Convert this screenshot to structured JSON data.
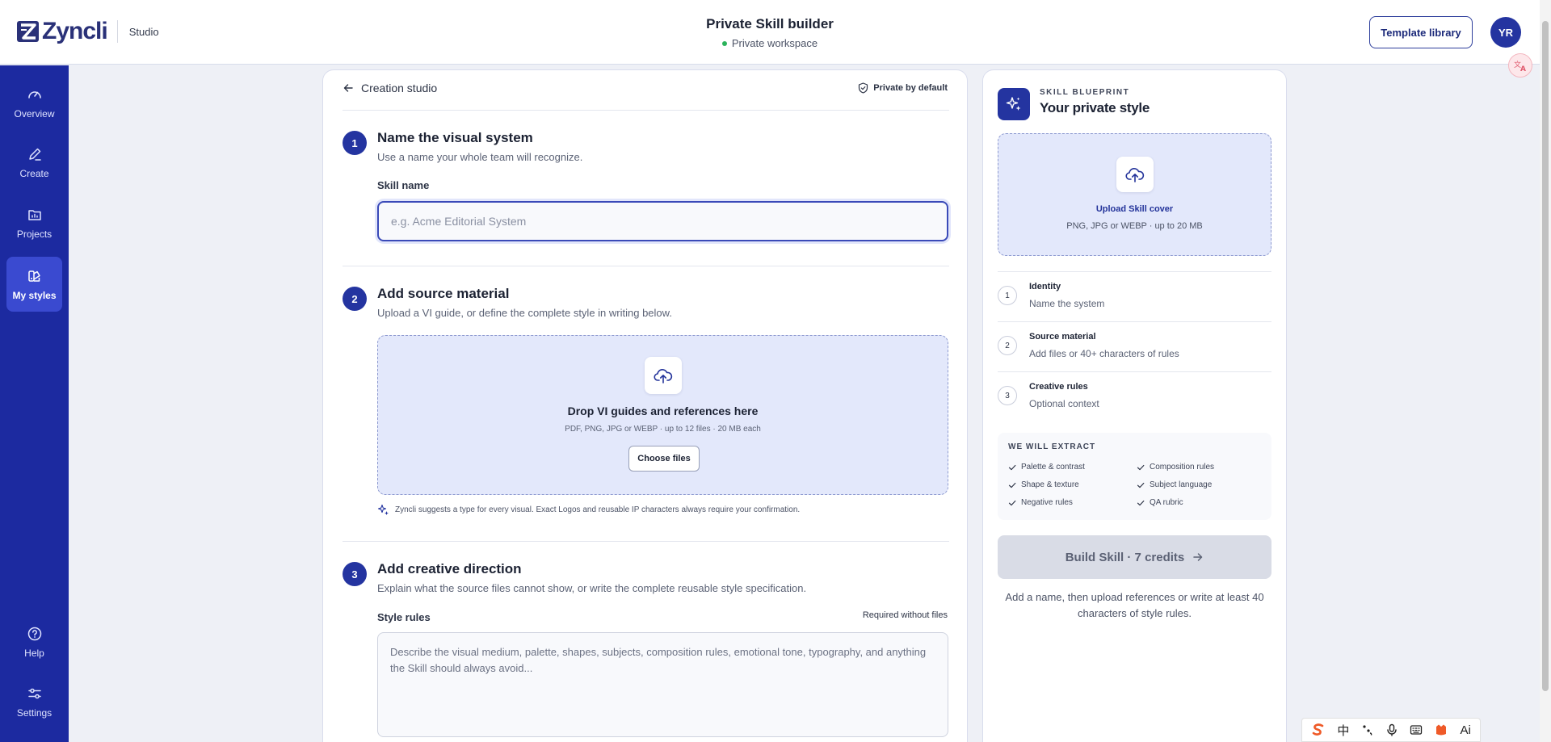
{
  "app": {
    "brand": "Zyncli",
    "section": "Studio",
    "title": "Private Skill builder",
    "workspace_status": "Private workspace",
    "template_library_label": "Template library",
    "user_initials": "YR"
  },
  "sidebar": {
    "items": [
      {
        "label": "Overview",
        "icon": "gauge-icon"
      },
      {
        "label": "Create",
        "icon": "pencil-icon"
      },
      {
        "label": "Projects",
        "icon": "chart-folder-icon"
      },
      {
        "label": "My styles",
        "icon": "palette-icon",
        "active": true
      },
      {
        "label": "Help",
        "icon": "help-icon"
      },
      {
        "label": "Settings",
        "icon": "sliders-icon"
      }
    ]
  },
  "main": {
    "back_label": "Creation studio",
    "privacy_label": "Private by default",
    "step1": {
      "num": "1",
      "title": "Name the visual system",
      "desc": "Use a name your whole team will recognize.",
      "field_label": "Skill name",
      "placeholder": "e.g. Acme Editorial System",
      "value": ""
    },
    "step2": {
      "num": "2",
      "title": "Add source material",
      "desc": "Upload a VI guide, or define the complete style in writing below.",
      "drop_title": "Drop VI guides and references here",
      "drop_sub": "PDF, PNG, JPG or WEBP · up to 12 files · 20 MB each",
      "choose_label": "Choose files",
      "hint": "Zyncli suggests a type for every visual. Exact Logos and reusable IP characters always require your confirmation."
    },
    "step3": {
      "num": "3",
      "title": "Add creative direction",
      "desc": "Explain what the source files cannot show, or write the complete reusable style specification.",
      "field_label": "Style rules",
      "required_note": "Required without files",
      "placeholder": "Describe the visual medium, palette, shapes, subjects, composition rules, emotional tone, typography, and anything the Skill should always avoid..."
    }
  },
  "blueprint": {
    "eyebrow": "SKILL BLUEPRINT",
    "title": "Your private style",
    "cover_title": "Upload Skill cover",
    "cover_sub": "PNG, JPG or WEBP · up to 20 MB",
    "progress": [
      {
        "num": "1",
        "title": "Identity",
        "sub": "Name the system"
      },
      {
        "num": "2",
        "title": "Source material",
        "sub": "Add files or 40+ characters of rules"
      },
      {
        "num": "3",
        "title": "Creative rules",
        "sub": "Optional context"
      }
    ],
    "extract_title": "WE WILL EXTRACT",
    "extract_items": [
      "Palette & contrast",
      "Composition rules",
      "Shape & texture",
      "Subject language",
      "Negative rules",
      "QA rubric"
    ],
    "build_label": "Build Skill · 7 credits",
    "build_help": "Add a name, then upload references or write at least 40 characters of style rules."
  },
  "ime": {
    "mode_label": "中",
    "ai_label": "Ai"
  },
  "colors": {
    "brand_navy": "#1c2aa0",
    "accent": "#2434a0",
    "active_nav": "#3a4ad0",
    "dropzone_bg": "#e3e8fb",
    "status_green": "#2bb35b"
  }
}
